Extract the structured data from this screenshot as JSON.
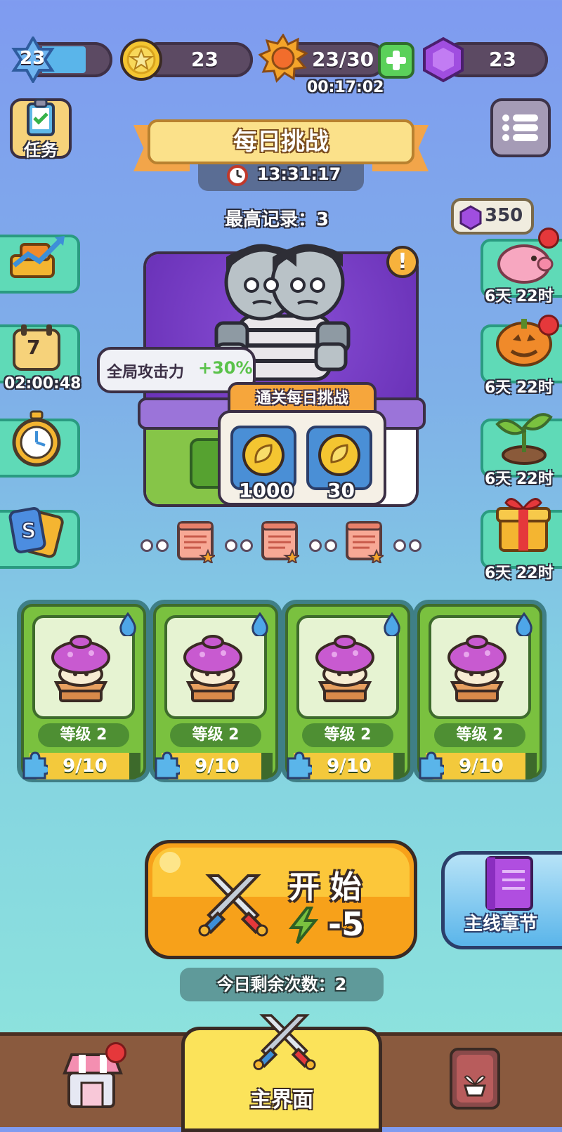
{
  "top_bar": {
    "level": "23",
    "level_progress": 0.62,
    "coins": "23",
    "energy": "23/30",
    "energy_timer": "00:17:02",
    "gems": "23"
  },
  "left_menu": {
    "tasks_label": "任务",
    "calendar_day": "7",
    "calendar_timer": "02:00:48"
  },
  "banner": {
    "title": "每日挑战",
    "timer": "13:31:17",
    "best_record": "最高记录：3"
  },
  "right_menu": {
    "piggy_price": "350",
    "timer_piggy": "6天 22时",
    "timer_pumpkin": "6天 22时",
    "timer_sprout": "6天 22时",
    "timer_gift": "6天 22时"
  },
  "challenge": {
    "buff_text": "全局攻击力",
    "buff_value": "+30%",
    "reward_title": "通关每日挑战",
    "reward_1": "1000",
    "reward_2": "30"
  },
  "cards": [
    {
      "level": "等级 2",
      "progress": "9/10",
      "ratio": 0.9
    },
    {
      "level": "等级 2",
      "progress": "9/10",
      "ratio": 0.9
    },
    {
      "level": "等级 2",
      "progress": "9/10",
      "ratio": 0.9
    },
    {
      "level": "等级 2",
      "progress": "9/10",
      "ratio": 0.9
    }
  ],
  "start": {
    "label": "开 始",
    "cost": "-5",
    "remaining": "今日剩余次数：2"
  },
  "chapter_label": "主线章节",
  "bottom_nav": {
    "main_label": "主界面"
  },
  "colors": {
    "accent_orange": "#f7a11a",
    "accent_green": "#5fdab7",
    "gem_purple": "#a04ee0",
    "nav_brown": "#8a5a3e"
  }
}
